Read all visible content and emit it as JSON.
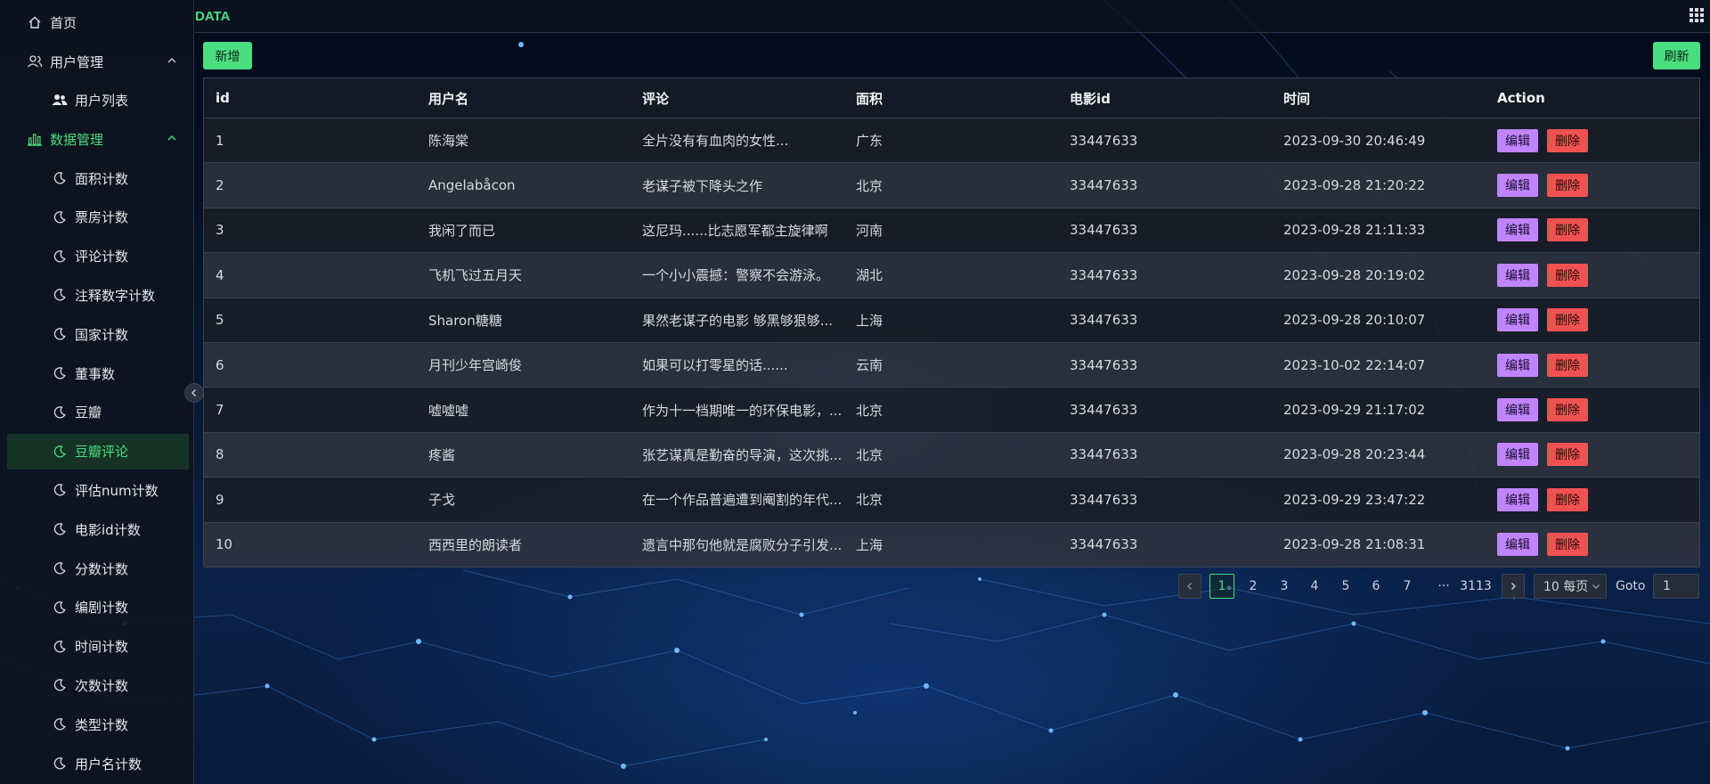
{
  "brand": "DATA",
  "sidebar": {
    "home": "首页",
    "user_mgmt": "用户管理",
    "user_list": "用户列表",
    "data_mgmt": "数据管理",
    "items": [
      "面积计数",
      "票房计数",
      "评论计数",
      "注释数字计数",
      "国家计数",
      "董事数",
      "豆瓣",
      "豆瓣评论",
      "评估num计数",
      "电影id计数",
      "分数计数",
      "编剧计数",
      "时间计数",
      "次数计数",
      "类型计数",
      "用户名计数"
    ],
    "active_item": "豆瓣评论"
  },
  "toolbar": {
    "add_label": "新增",
    "refresh_label": "刷新"
  },
  "table": {
    "columns": [
      "id",
      "用户名",
      "评论",
      "面积",
      "电影id",
      "时间",
      "Action"
    ],
    "edit_label": "编辑",
    "delete_label": "删除",
    "rows": [
      [
        "1",
        "陈海棠",
        "全片没有有血肉的女性...",
        "广东",
        "33447633",
        "2023-09-30 20:46:49"
      ],
      [
        "2",
        "Angelabåcon",
        "老谋子被下降头之作",
        "北京",
        "33447633",
        "2023-09-28 21:20:22"
      ],
      [
        "3",
        "我闲了而已",
        "这尼玛......比志愿军都主旋律啊",
        "河南",
        "33447633",
        "2023-09-28 21:11:33"
      ],
      [
        "4",
        "飞机飞过五月天",
        "一个小小震撼：警察不会游泳。",
        "湖北",
        "33447633",
        "2023-09-28 20:19:02"
      ],
      [
        "5",
        "Sharon糖糖",
        "果然老谋子的电影 够黑够狠够...",
        "上海",
        "33447633",
        "2023-09-28 20:10:07"
      ],
      [
        "6",
        "月刊少年宫崎俊",
        "如果可以打零星的话......",
        "云南",
        "33447633",
        "2023-10-02 22:14:07"
      ],
      [
        "7",
        "嘘嘘嘘",
        "作为十一档期唯一的环保电影，...",
        "北京",
        "33447633",
        "2023-09-29 21:17:02"
      ],
      [
        "8",
        "疼酱",
        "张艺谋真是勤奋的导演，这次挑...",
        "北京",
        "33447633",
        "2023-09-28 20:23:44"
      ],
      [
        "9",
        "子戈",
        "在一个作品普遍遭到阉割的年代...",
        "北京",
        "33447633",
        "2023-09-29 23:47:22"
      ],
      [
        "10",
        "西西里的朗读者",
        "遗言中那句他就是腐败分子引发...",
        "上海",
        "33447633",
        "2023-09-28 21:08:31"
      ]
    ]
  },
  "pagination": {
    "pages": [
      "1",
      "2",
      "3",
      "4",
      "5",
      "6",
      "7",
      "···",
      "3113"
    ],
    "current": "1",
    "page_size": "10 每页",
    "goto_label": "Goto",
    "goto_value": "1"
  },
  "colors": {
    "accent": "#4ade80",
    "edit": "#c084fc",
    "delete": "#f05252"
  }
}
